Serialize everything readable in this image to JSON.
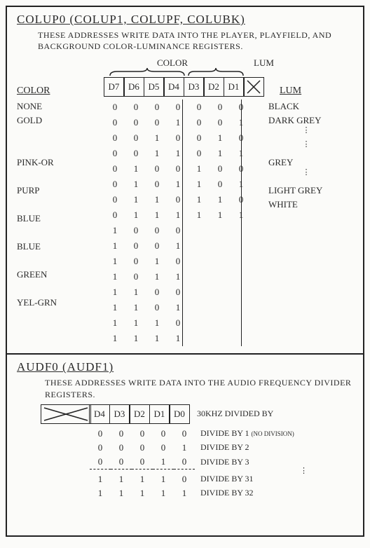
{
  "colup": {
    "title": "COLUP0 (COLUP1, COLUPF, COLUBK)",
    "desc": "THESE ADDRESSES WRITE DATA INTO THE PLAYER, PLAYFIELD, AND BACKGROUND COLOR-LUMINANCE REGISTERS.",
    "brace_color": "COLOR",
    "brace_lum": "LUM",
    "color_hdr": "COLOR",
    "lum_hdr": "LUM",
    "bits": [
      "D7",
      "D6",
      "D5",
      "D4",
      "D3",
      "D2",
      "D1"
    ],
    "color_rows": [
      {
        "name": "NONE",
        "b": [
          "0",
          "0",
          "0",
          "0"
        ]
      },
      {
        "name": "GOLD",
        "b": [
          "0",
          "0",
          "0",
          "1"
        ]
      },
      {
        "name": "",
        "b": [
          "0",
          "0",
          "1",
          "0"
        ]
      },
      {
        "name": "",
        "b": [
          "0",
          "0",
          "1",
          "1"
        ]
      },
      {
        "name": "PINK-OR",
        "b": [
          "0",
          "1",
          "0",
          "0"
        ]
      },
      {
        "name": "",
        "b": [
          "0",
          "1",
          "0",
          "1"
        ]
      },
      {
        "name": "PURP",
        "b": [
          "0",
          "1",
          "1",
          "0"
        ]
      },
      {
        "name": "",
        "b": [
          "0",
          "1",
          "1",
          "1"
        ]
      },
      {
        "name": "BLUE",
        "b": [
          "1",
          "0",
          "0",
          "0"
        ]
      },
      {
        "name": "",
        "b": [
          "1",
          "0",
          "0",
          "1"
        ]
      },
      {
        "name": "BLUE",
        "b": [
          "1",
          "0",
          "1",
          "0"
        ]
      },
      {
        "name": "",
        "b": [
          "1",
          "0",
          "1",
          "1"
        ]
      },
      {
        "name": "GREEN",
        "b": [
          "1",
          "1",
          "0",
          "0"
        ]
      },
      {
        "name": "",
        "b": [
          "1",
          "1",
          "0",
          "1"
        ]
      },
      {
        "name": "YEL-GRN",
        "b": [
          "1",
          "1",
          "1",
          "0"
        ]
      },
      {
        "name": "",
        "b": [
          "1",
          "1",
          "1",
          "1"
        ]
      }
    ],
    "lum_rows": [
      {
        "name": "BLACK",
        "b": [
          "0",
          "0",
          "0"
        ]
      },
      {
        "name": "DARK GREY",
        "b": [
          "0",
          "0",
          "1"
        ]
      },
      {
        "name": "",
        "b": [
          "0",
          "1",
          "0"
        ]
      },
      {
        "name": "",
        "b": [
          "0",
          "1",
          "1"
        ]
      },
      {
        "name": "GREY",
        "b": [
          "1",
          "0",
          "0"
        ]
      },
      {
        "name": "",
        "b": [
          "1",
          "0",
          "1"
        ]
      },
      {
        "name": "LIGHT GREY",
        "b": [
          "1",
          "1",
          "0"
        ]
      },
      {
        "name": "WHITE",
        "b": [
          "1",
          "1",
          "1"
        ]
      }
    ]
  },
  "audf": {
    "title": "AUDF0 (AUDF1)",
    "desc": "THESE ADDRESSES WRITE DATA INTO THE AUDIO FREQUENCY DIVIDER REGISTERS.",
    "bits": [
      "D4",
      "D3",
      "D2",
      "D1",
      "D0"
    ],
    "right_label": "30KHZ DIVIDED BY",
    "rows": [
      {
        "b": [
          "0",
          "0",
          "0",
          "0",
          "0"
        ],
        "label": "DIVIDE BY 1",
        "note": "(NO DIVISION)"
      },
      {
        "b": [
          "0",
          "0",
          "0",
          "0",
          "1"
        ],
        "label": "DIVIDE BY 2",
        "note": ""
      },
      {
        "b": [
          "0",
          "0",
          "0",
          "1",
          "0"
        ],
        "label": "DIVIDE BY 3",
        "note": ""
      }
    ],
    "rows_after": [
      {
        "b": [
          "1",
          "1",
          "1",
          "1",
          "0"
        ],
        "label": "DIVIDE BY 31",
        "note": ""
      },
      {
        "b": [
          "1",
          "1",
          "1",
          "1",
          "1"
        ],
        "label": "DIVIDE BY 32",
        "note": ""
      }
    ]
  }
}
